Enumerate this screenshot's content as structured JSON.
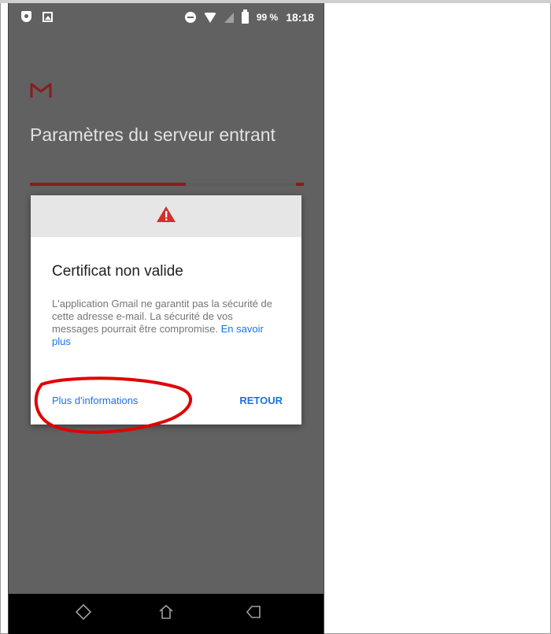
{
  "status_bar": {
    "left_icons": [
      "shield-icon",
      "image-icon"
    ],
    "right_icons": [
      "do-not-disturb-icon",
      "wifi-icon",
      "signal-icon",
      "battery-icon"
    ],
    "battery": "99 %",
    "time": "18:18"
  },
  "app": {
    "logo_icon": "gmail-logo-icon",
    "accent": "#c5221f",
    "title": "Paramètres du serveur entrant",
    "setup_progress": 0.57
  },
  "dialog": {
    "header_icon": "warning-icon",
    "title": "Certificat non valide",
    "body": "L'application Gmail ne garantit pas la sécurité de cette adresse e-mail. La sécurité de vos messages pourrait être compromise.",
    "learn_more": "En savoir plus",
    "more_info_button": "Plus d'informations",
    "back_button": "RETOUR",
    "link_color": "#1a73e8"
  },
  "annotation": {
    "color": "#e00000"
  },
  "nav_bar": {
    "icons": [
      "recent-apps-icon",
      "home-icon",
      "back-icon"
    ]
  }
}
